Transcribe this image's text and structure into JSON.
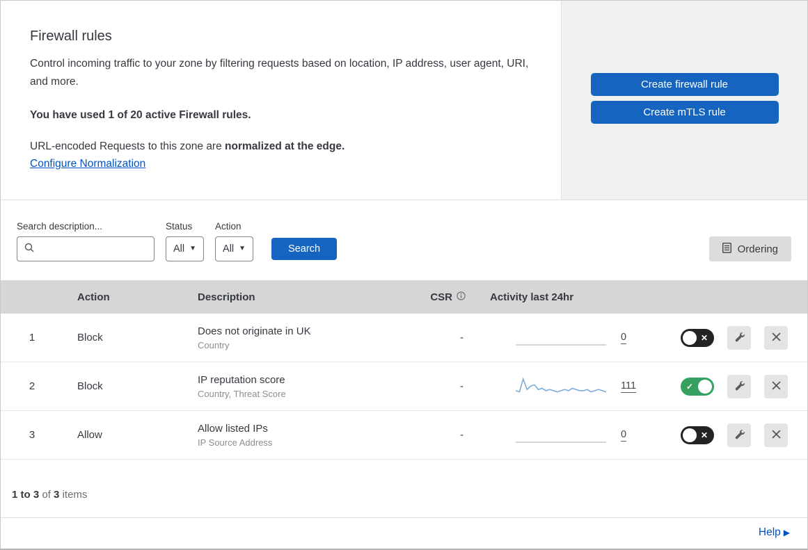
{
  "colors": {
    "accent": "#1565c0",
    "link": "#0051c3",
    "toggle_on": "#35a05f",
    "toggle_off": "#232323",
    "sparkline": "#74a9d8",
    "header_bg": "#d6d6d6"
  },
  "header": {
    "title": "Firewall rules",
    "description": "Control incoming traffic to your zone by filtering requests based on location, IP address, user agent, URI, and more.",
    "usage": "You have used 1 of 20 active Firewall rules.",
    "normalization_prefix": "URL-encoded Requests to this zone are",
    "normalization_bold": "normalized at the edge.",
    "normalization_link": "Configure Normalization",
    "buttons": {
      "create_firewall": "Create firewall rule",
      "create_mtls": "Create mTLS rule"
    }
  },
  "filters": {
    "search_label": "Search description...",
    "search_value": "",
    "status_label": "Status",
    "status_value": "All",
    "action_label": "Action",
    "action_value": "All",
    "search_button": "Search",
    "ordering_button": "Ordering"
  },
  "table": {
    "headers": {
      "action": "Action",
      "description": "Description",
      "csr": "CSR",
      "activity": "Activity last 24hr"
    },
    "rows": [
      {
        "num": "1",
        "action": "Block",
        "description": "Does not originate in UK",
        "fields": "Country",
        "csr": "-",
        "activity": "0",
        "enabled": false,
        "sparkline": []
      },
      {
        "num": "2",
        "action": "Block",
        "description": "IP reputation score",
        "fields": "Country, Threat Score",
        "csr": "-",
        "activity": "111",
        "enabled": true,
        "sparkline": [
          3,
          2,
          13,
          4,
          7,
          8,
          4,
          5,
          3,
          4,
          3,
          2,
          3,
          4,
          3,
          5,
          4,
          3,
          3,
          4,
          2,
          3,
          4,
          3,
          2
        ]
      },
      {
        "num": "3",
        "action": "Allow",
        "description": "Allow listed IPs",
        "fields": "IP Source Address",
        "csr": "-",
        "activity": "0",
        "enabled": false,
        "sparkline": []
      }
    ]
  },
  "footer": {
    "range": "1 to 3",
    "of": "of",
    "total": "3",
    "items": "items"
  },
  "help": {
    "label": "Help"
  }
}
